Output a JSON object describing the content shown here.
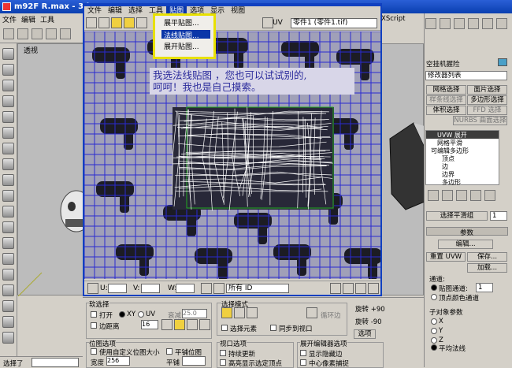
{
  "max_window": {
    "title": "m92F R.max - 3ds",
    "menu": [
      "文件",
      "编辑",
      "工具"
    ]
  },
  "viewport_left": {
    "label": "透视"
  },
  "unwrap_window": {
    "menu": [
      "文件",
      "编辑",
      "选择",
      "工具",
      "贴图",
      "选项",
      "显示",
      "视图"
    ],
    "combo_label": "UV",
    "combo_value": "零件1 (零件1.tif)",
    "script_label": "XScript",
    "statusbar": {
      "u_label": "U:",
      "v_label": "V:",
      "w_label": "W:",
      "id_combo": "所有 ID"
    }
  },
  "dropdown_menu": {
    "items": [
      "展平贴图...",
      "法线贴图...",
      "展开贴图..."
    ],
    "selected_index": 1
  },
  "note": {
    "line1": "我选法线贴图 ，您也可以试试别的,",
    "line2": "呵呵！我也是自己摸索。"
  },
  "command_panel": {
    "object_name": "空挂机握险",
    "modifier_list": "修改器列表",
    "buttons": [
      "网格选择",
      "面片选择",
      "样条线选择",
      "多边形选择",
      "体积选择",
      "FFD 选择",
      "NURBS 曲面选择"
    ],
    "stack": [
      "UVW 展开",
      "网格平滑",
      "可编辑多边形",
      "顶点",
      "边",
      "边界",
      "多边形"
    ],
    "select_by_sg": "选择平滑组",
    "select_by_sg_value": "1",
    "params_title": "参数",
    "edit_button": "编辑...",
    "reset_uvw": "重置 UVW",
    "save_button": "保存...",
    "load_button": "加载...",
    "channel_label": "通道:",
    "map_channel": "贴图通道:",
    "map_channel_value": "1",
    "vertex_color_channel": "顶点颜色通道",
    "sub_params": "子对象参数",
    "axes": [
      "X",
      "Y",
      "Z"
    ],
    "avg_normals": "平均法线"
  },
  "bottom_panel": {
    "soft_select": "软选择",
    "on_label": "打开",
    "xy_label": "XY",
    "uv_label": "UV",
    "falloff_label": "衰减",
    "falloff_value": "25.0",
    "edge_distance": "边距离",
    "edge_distance_value": "16",
    "select_mode": "选择模式",
    "select_elements": "选择元素",
    "sync_viewport": "同步到视口",
    "rotate_plus": "旋转 +90",
    "rotate_minus": "旋转 -90",
    "options_button": "选项",
    "loop_button": "循环边",
    "bitmap_options": "位图选项",
    "use_custom_bitmap": "使用自定义位图大小",
    "tile_bitmap": "平铺位图",
    "width_label": "宽度",
    "width_value": "256",
    "brightness_label": "平铺",
    "viewport_options": "视口选项",
    "constant_update": "持续更新",
    "show_selected": "高亮显示选定顶点",
    "unfold_options": "展开编辑器选项",
    "show_hidden": "显示隐藏边",
    "center_pick": "中心像素捕捉"
  },
  "status": {
    "selected_label": "选择了",
    "selected_value": ""
  }
}
